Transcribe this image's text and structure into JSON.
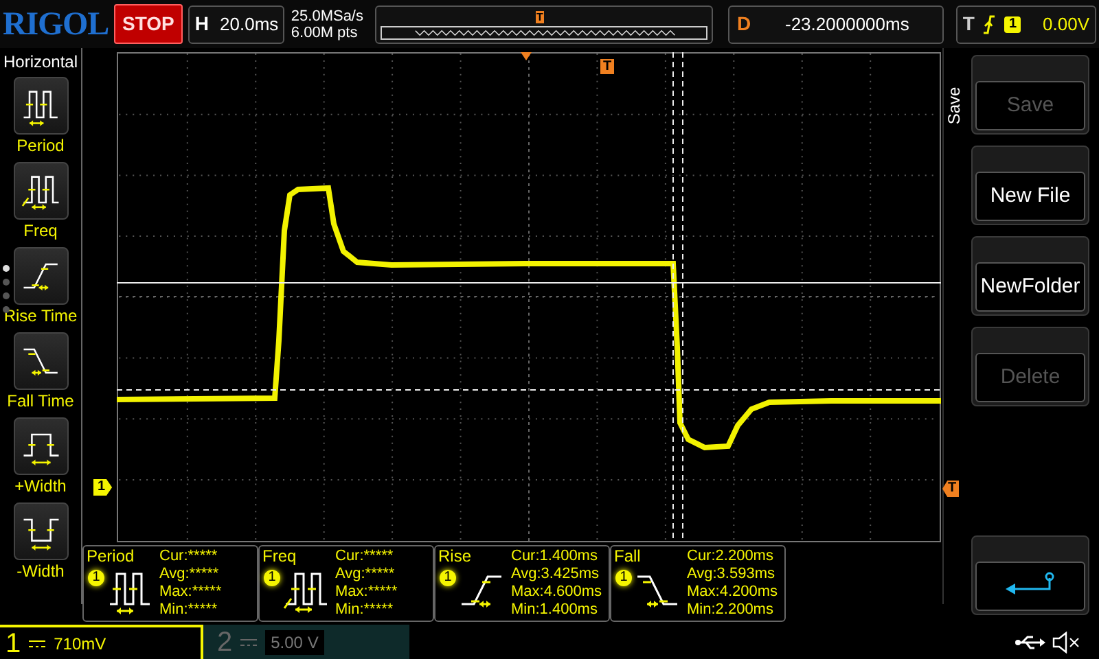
{
  "brand": "RIGOL",
  "run_state": {
    "label": "STOP",
    "kind": "stop"
  },
  "timebase": {
    "label": "H",
    "value": "20.0ms"
  },
  "sample_rate": "25.0MSa/s",
  "memory_depth": "6.00M pts",
  "overview_marker": "T",
  "delay": {
    "label": "D",
    "value": "-23.2000000ms"
  },
  "trigger": {
    "label": "T",
    "source": "1",
    "level": "0.00V"
  },
  "left_panel": {
    "title": "Horizontal",
    "items": [
      {
        "label": "Period",
        "kind": "period"
      },
      {
        "label": "Freq",
        "kind": "freq"
      },
      {
        "label": "Rise Time",
        "kind": "rise"
      },
      {
        "label": "Fall Time",
        "kind": "fall"
      },
      {
        "label": "+Width",
        "kind": "pos_width"
      },
      {
        "label": "-Width",
        "kind": "neg_width"
      }
    ],
    "pages": [
      {
        "selected": true
      },
      {
        "selected": false
      },
      {
        "selected": false
      },
      {
        "selected": false
      }
    ]
  },
  "grid_markers": {
    "trigger_top": "T",
    "channel": "1",
    "trigger_level": "T"
  },
  "side_menu": {
    "title": "Save",
    "buttons": [
      {
        "kind": "text",
        "label": "Save",
        "disabled": true
      },
      {
        "kind": "text",
        "label": "New File",
        "disabled": false
      },
      {
        "kind": "text",
        "label": "NewFolder",
        "disabled": false
      },
      {
        "kind": "text",
        "label": "Delete",
        "disabled": true
      },
      {
        "kind": "return"
      }
    ]
  },
  "measurements": [
    {
      "name": "Period",
      "channel": "1",
      "kind": "period",
      "lines": [
        "Cur:*****",
        "Avg:*****",
        "Max:*****",
        "Min:*****"
      ]
    },
    {
      "name": "Freq",
      "channel": "1",
      "kind": "freq",
      "lines": [
        "Cur:*****",
        "Avg:*****",
        "Max:*****",
        "Min:*****"
      ]
    },
    {
      "name": "Rise",
      "channel": "1",
      "kind": "rise",
      "lines": [
        "Cur:1.400ms",
        "Avg:3.425ms",
        "Max:4.600ms",
        "Min:1.400ms"
      ]
    },
    {
      "name": "Fall",
      "channel": "1",
      "kind": "fall",
      "lines": [
        "Cur:2.200ms",
        "Avg:3.593ms",
        "Max:4.200ms",
        "Min:2.200ms"
      ]
    }
  ],
  "channels": [
    {
      "number": "1",
      "scale": "710mV",
      "selected": true
    },
    {
      "number": "2",
      "scale": "5.00 V",
      "selected": false
    }
  ]
}
